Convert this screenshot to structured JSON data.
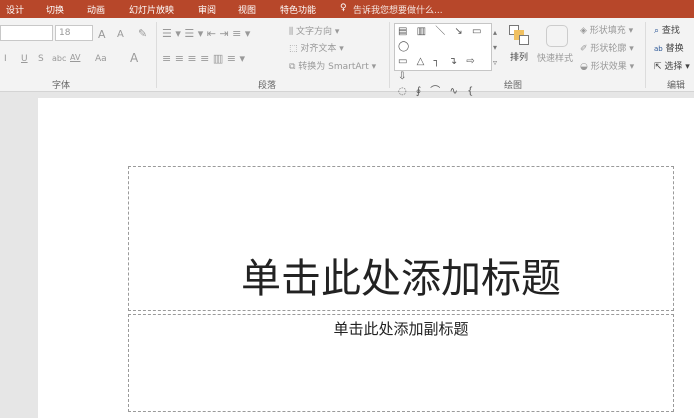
{
  "tabs": [
    "设计",
    "切换",
    "动画",
    "幻灯片放映",
    "审阅",
    "视图",
    "特色功能"
  ],
  "tell_me": "告诉我您想要做什么...",
  "font": {
    "size": "18",
    "group": "字体",
    "grow": "A",
    "shrink": "A",
    "italic": "I",
    "underline": "U",
    "strike": "S",
    "abc": "abc",
    "spacing": "AV",
    "case": "Aa",
    "color": "A"
  },
  "paragraph": {
    "group": "段落",
    "text_direction": "文字方向",
    "align_text": "对齐文本",
    "smartart": "转换为 SmartArt"
  },
  "drawing": {
    "group": "绘图",
    "arrange": "排列",
    "quick_styles": "快速样式",
    "fill": "形状填充",
    "outline": "形状轮廓",
    "effects": "形状效果",
    "shapes_rows": [
      "▤ ▥ ＼ ↘ ▭ ◯",
      "▭ △ ┐ ↴ ⇨ ⇩",
      "◌ ∮ ⌒ ∿ { }"
    ]
  },
  "editing": {
    "group": "编辑",
    "find": "查找",
    "replace": "替换",
    "select": "选择"
  },
  "slide": {
    "title_placeholder": "单击此处添加标题",
    "subtitle_placeholder": "单击此处添加副标题"
  },
  "colors": {
    "accent": "#b7472a"
  }
}
